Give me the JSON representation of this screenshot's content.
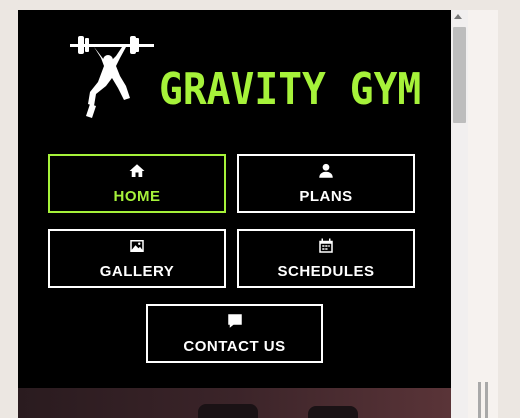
{
  "brand": {
    "name": "GRAVITY GYM"
  },
  "nav": {
    "home": {
      "label": "HOME",
      "icon": "home-icon"
    },
    "plans": {
      "label": "PLANS",
      "icon": "user-icon"
    },
    "gallery": {
      "label": "GALLERY",
      "icon": "image-icon"
    },
    "schedules": {
      "label": "SCHEDULES",
      "icon": "calendar-icon"
    },
    "contact": {
      "label": "CONTACT US",
      "icon": "comment-icon"
    }
  },
  "colors": {
    "accent": "#a6f23a",
    "background": "#000000",
    "text": "#ffffff"
  }
}
